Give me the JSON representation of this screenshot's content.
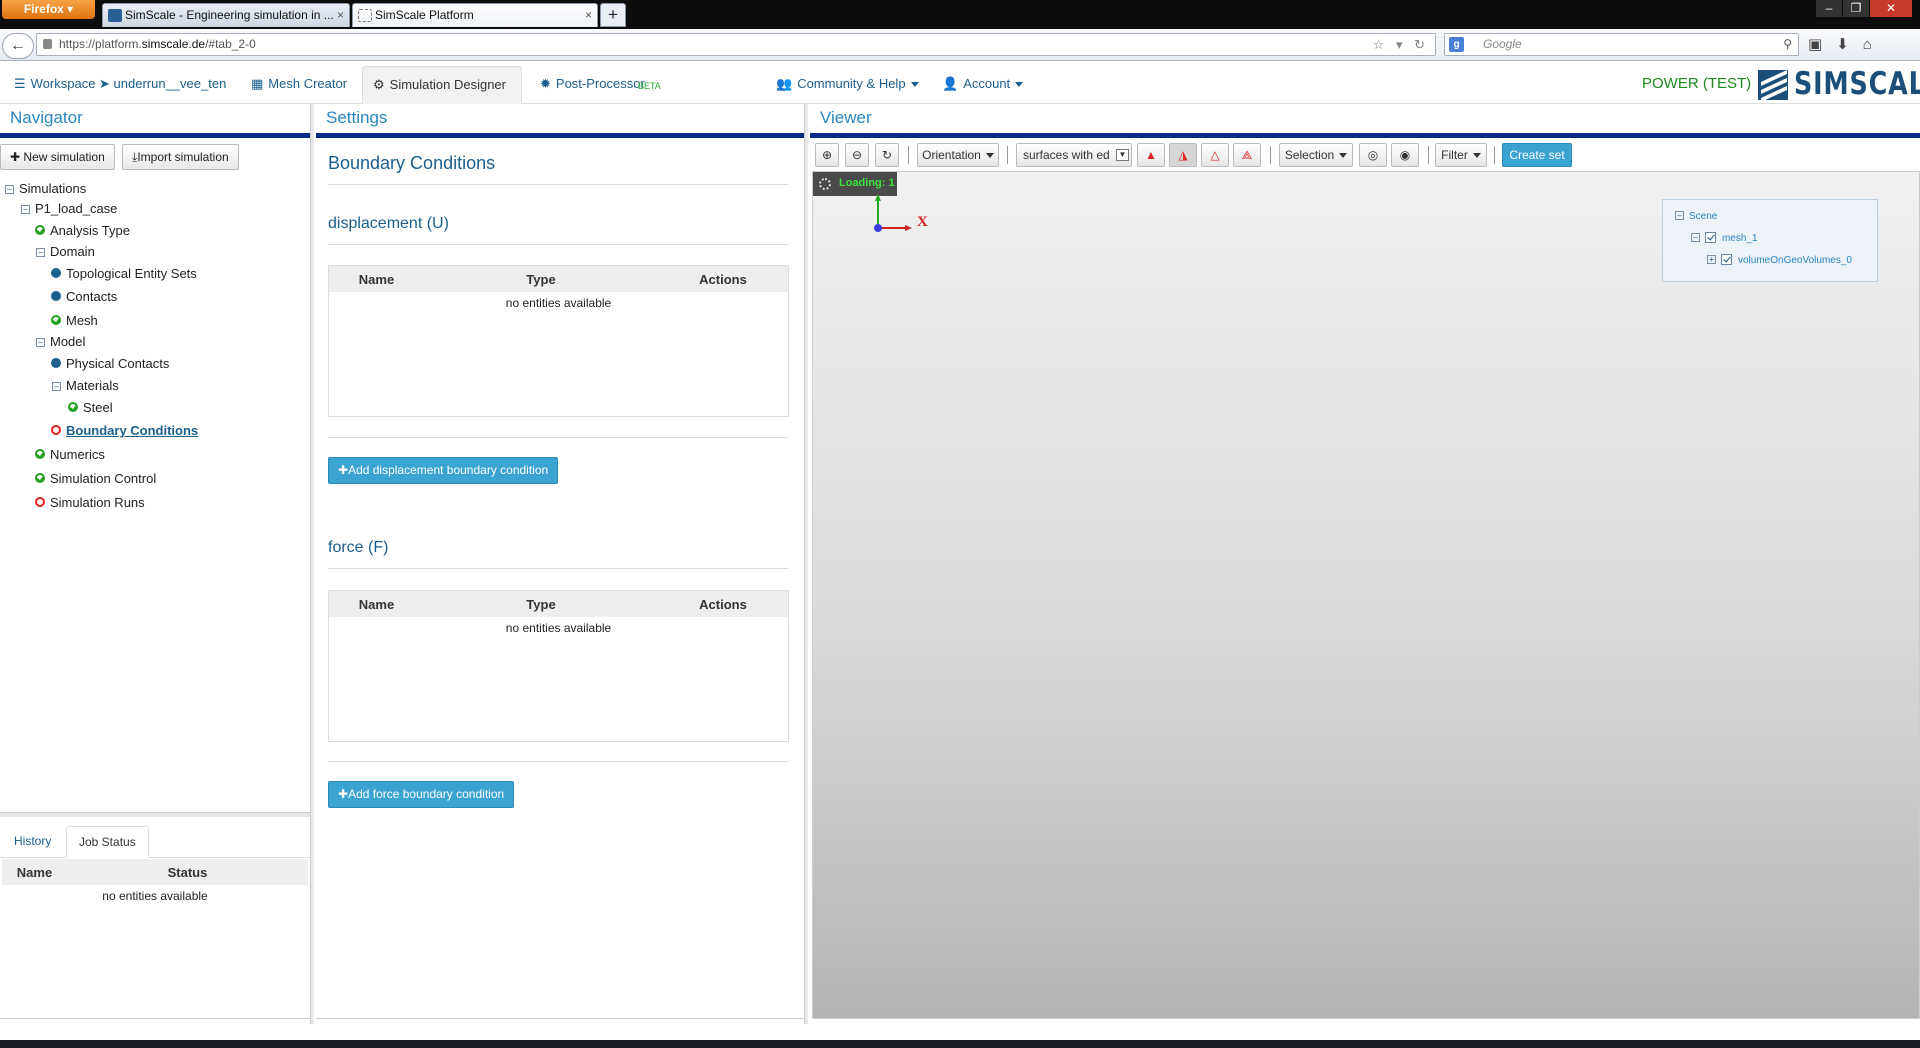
{
  "browser": {
    "menu_label": "Firefox",
    "tabs": [
      {
        "title": "SimScale - Engineering simulation in ...",
        "close": "×"
      },
      {
        "title": "SimScale Platform",
        "close": "×"
      }
    ],
    "new_tab": "+",
    "url_host_prefix": "https://platform.",
    "url_host": "simscale.de",
    "url_path": "/#tab_2-0",
    "search_placeholder": "Google",
    "window_controls": [
      "–",
      "❐",
      "✕"
    ]
  },
  "app": {
    "tabs": [
      {
        "label": "Workspace ➤ underrun__vee_ten",
        "icon": "server-icon"
      },
      {
        "label": "Mesh Creator",
        "icon": "grid-icon"
      },
      {
        "label": "Simulation Designer",
        "icon": "gears-icon"
      },
      {
        "label": "Post-Processor",
        "icon": "gear-icon",
        "badge": "BETA"
      },
      {
        "label": "Community & Help",
        "icon": "users-icon"
      },
      {
        "label": "Account",
        "icon": "user-icon"
      }
    ],
    "plan_label": "POWER (TEST)",
    "logo_text": "SIMSCALE",
    "brand_color": "#1b4f7a",
    "accent_color": "#2a86c0",
    "rule_color": "#0b2a85"
  },
  "navigator": {
    "title": "Navigator",
    "new_simulation": "New simulation",
    "import_simulation": "Import simulation",
    "tree": {
      "simulations": "Simulations",
      "load_case": "P1_load_case",
      "analysis_type": "Analysis Type",
      "domain": "Domain",
      "topological_entity_sets": "Topological Entity Sets",
      "contacts": "Contacts",
      "mesh": "Mesh",
      "model": "Model",
      "physical_contacts": "Physical Contacts",
      "materials": "Materials",
      "steel": "Steel",
      "boundary_conditions": "Boundary Conditions",
      "numerics": "Numerics",
      "simulation_control": "Simulation Control",
      "simulation_runs": "Simulation Runs"
    },
    "bottom_tabs": {
      "history": "History",
      "job_status": "Job Status"
    },
    "job_table": {
      "col_name": "Name",
      "col_status": "Status",
      "empty": "no entities available"
    }
  },
  "settings": {
    "title": "Settings",
    "heading": "Boundary Conditions",
    "displacement": {
      "title": "displacement (U)",
      "col_name": "Name",
      "col_type": "Type",
      "col_actions": "Actions",
      "empty": "no entities available",
      "add_button": "Add displacement boundary condition"
    },
    "force": {
      "title": "force (F)",
      "col_name": "Name",
      "col_type": "Type",
      "col_actions": "Actions",
      "empty": "no entities available",
      "add_button": "Add force boundary condition"
    }
  },
  "viewer": {
    "title": "Viewer",
    "orientation": "Orientation",
    "render_mode": "surfaces with ed",
    "selection": "Selection",
    "filter": "Filter",
    "create_set": "Create set",
    "loading": "Loading: 1",
    "axis_label": "X",
    "scene_tree": {
      "root": "Scene",
      "mesh": "mesh_1",
      "volume": "volumeOnGeoVolumes_0"
    }
  }
}
